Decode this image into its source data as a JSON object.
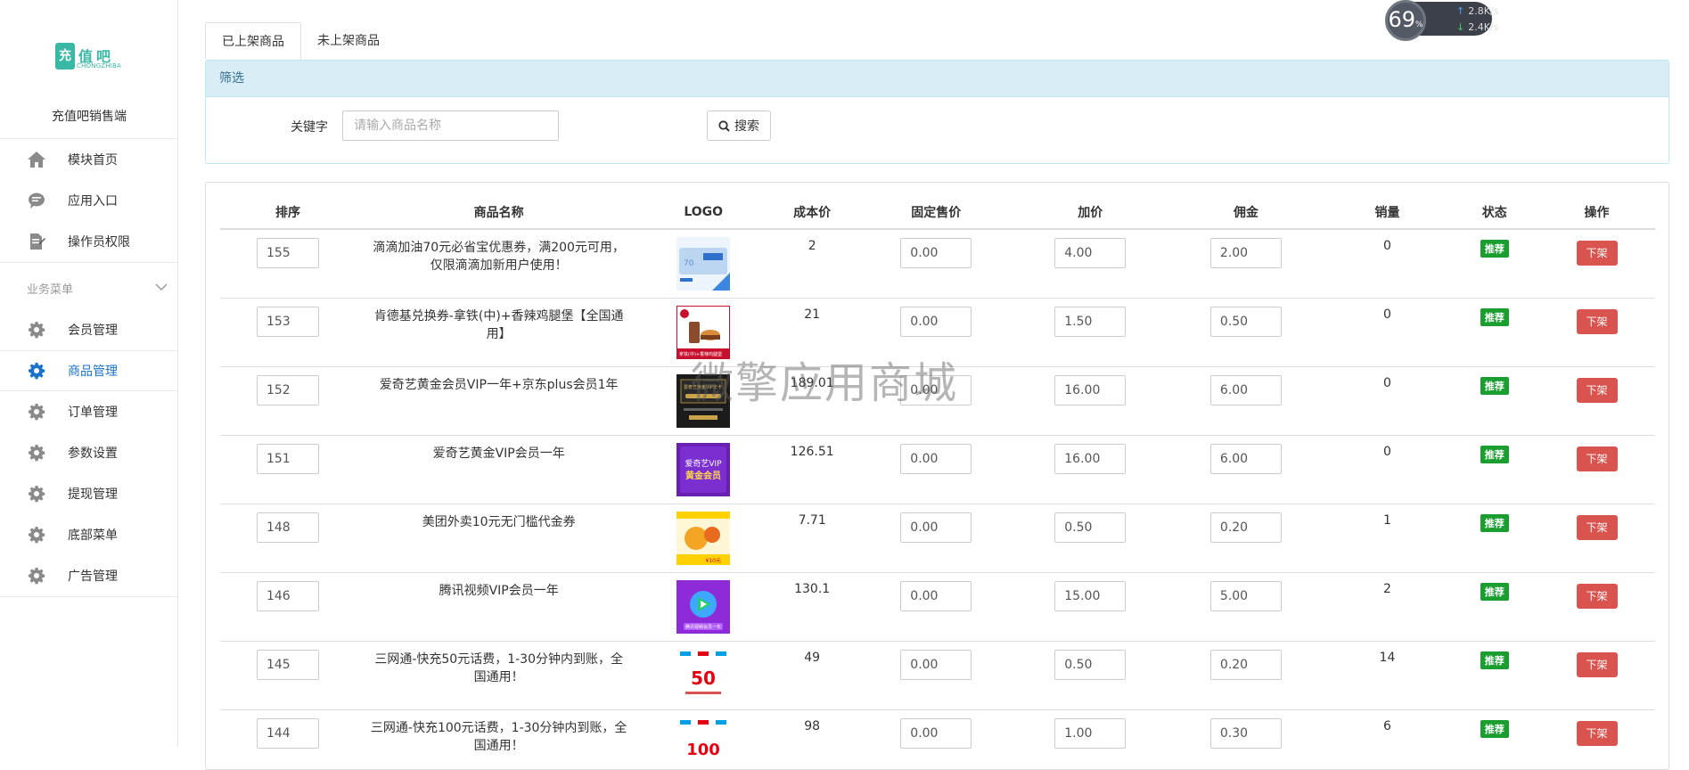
{
  "brand": {
    "logo_cn": "值吧",
    "logo_box": "充",
    "logo_en": "CHONGZHIBA",
    "shop_title": "充值吧销售端"
  },
  "sidebar": {
    "main_items": [
      {
        "label": "模块首页",
        "icon": "home-icon"
      },
      {
        "label": "应用入口",
        "icon": "chat-icon"
      },
      {
        "label": "操作员权限",
        "icon": "edit-doc-icon"
      }
    ],
    "group_title": "业务菜单",
    "group_items": [
      {
        "label": "会员管理",
        "icon": "gear-icon",
        "active": false
      },
      {
        "label": "商品管理",
        "icon": "gear-icon",
        "active": true
      },
      {
        "label": "订单管理",
        "icon": "gear-icon",
        "active": false
      },
      {
        "label": "参数设置",
        "icon": "gear-icon",
        "active": false
      },
      {
        "label": "提现管理",
        "icon": "gear-icon",
        "active": false
      },
      {
        "label": "底部菜单",
        "icon": "gear-icon",
        "active": false
      },
      {
        "label": "广告管理",
        "icon": "gear-icon",
        "active": false
      }
    ]
  },
  "tabs": [
    {
      "label": "已上架商品",
      "active": true
    },
    {
      "label": "未上架商品",
      "active": false
    }
  ],
  "filter": {
    "title": "筛选",
    "keyword_label": "关键字",
    "keyword_placeholder": "请输入商品名称",
    "search_label": "搜索"
  },
  "table": {
    "headers": [
      "排序",
      "商品名称",
      "LOGO",
      "成本价",
      "固定售价",
      "加价",
      "佣金",
      "销量",
      "状态",
      "操作"
    ],
    "rows": [
      {
        "sort": "155",
        "name": "滴滴加油70元必省宝优惠券，满200元可用，仅限滴滴加新用户使用！",
        "cost": "2",
        "fixed": "0.00",
        "markup": "4.00",
        "commission": "2.00",
        "sales": "0",
        "status": "推荐",
        "action": "下架",
        "logo": "didi"
      },
      {
        "sort": "153",
        "name": "肯德基兑换券-拿铁(中)+香辣鸡腿堡【全国通用】",
        "cost": "21",
        "fixed": "0.00",
        "markup": "1.50",
        "commission": "0.50",
        "sales": "0",
        "status": "推荐",
        "action": "下架",
        "logo": "kfc"
      },
      {
        "sort": "152",
        "name": "爱奇艺黄金会员VIP一年+京东plus会员1年",
        "cost": "189.01",
        "fixed": "0.00",
        "markup": "16.00",
        "commission": "6.00",
        "sales": "0",
        "status": "推荐",
        "action": "下架",
        "logo": "iqiyi-jd"
      },
      {
        "sort": "151",
        "name": "爱奇艺黄金VIP会员一年",
        "cost": "126.51",
        "fixed": "0.00",
        "markup": "16.00",
        "commission": "6.00",
        "sales": "0",
        "status": "推荐",
        "action": "下架",
        "logo": "iqiyi"
      },
      {
        "sort": "148",
        "name": "美团外卖10元无门槛代金券",
        "cost": "7.71",
        "fixed": "0.00",
        "markup": "0.50",
        "commission": "0.20",
        "sales": "1",
        "status": "推荐",
        "action": "下架",
        "logo": "meituan"
      },
      {
        "sort": "146",
        "name": "腾讯视频VIP会员一年",
        "cost": "130.1",
        "fixed": "0.00",
        "markup": "15.00",
        "commission": "5.00",
        "sales": "2",
        "status": "推荐",
        "action": "下架",
        "logo": "tencent"
      },
      {
        "sort": "145",
        "name": "三网通-快充50元话费，1-30分钟内到账，全国通用！",
        "cost": "49",
        "fixed": "0.00",
        "markup": "0.50",
        "commission": "0.20",
        "sales": "14",
        "status": "推荐",
        "action": "下架",
        "logo": "phone50"
      },
      {
        "sort": "144",
        "name": "三网通-快充100元话费，1-30分钟内到账，全国通用！",
        "cost": "98",
        "fixed": "0.00",
        "markup": "1.00",
        "commission": "0.30",
        "sales": "6",
        "status": "推荐",
        "action": "下架",
        "logo": "phone100"
      }
    ]
  },
  "logo_texts": {
    "didi_num": "70",
    "kfc_caption": "拿铁(中)+香辣鸡腿堡",
    "iqiyi_jd_text": "爱奇艺黄金VIP年卡",
    "iqiyi_line1": "爱奇艺VIP",
    "iqiyi_line2": "黄金会员",
    "meituan_amount": "¥10元",
    "tencent_caption": "腾讯视频会员一年",
    "phone50_amount": "50",
    "phone100_amount": "100"
  },
  "net_widget": {
    "percent": "69",
    "percent_unit": "%",
    "up": "2.8",
    "down": "2.4",
    "unit": "K/s"
  },
  "watermark": "微擎应用商城",
  "colors": {
    "accent": "#1a73c8",
    "brand": "#3ab8a6",
    "badge_green": "#1a9e2f",
    "danger": "#d9534f",
    "info_bg": "#d9edf7"
  }
}
